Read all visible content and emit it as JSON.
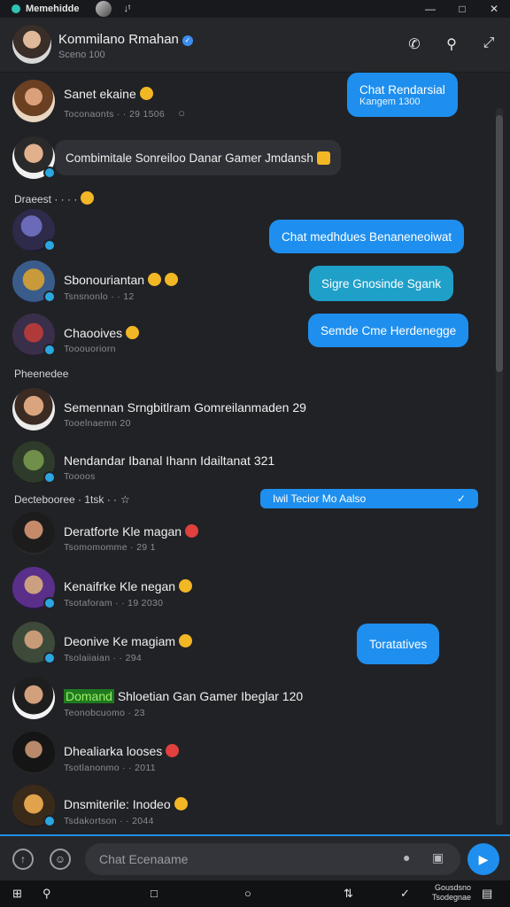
{
  "titlebar": {
    "app_name": "Memehidde",
    "tab_label": "↓ᵗ",
    "minimize": "—",
    "maximize": "□",
    "close": "✕"
  },
  "header": {
    "name": "Kommilano Rmahan",
    "status": "Sceno 100",
    "verified": "✓"
  },
  "rows": [
    {
      "name": "Sanet ekaine",
      "meta": "Toconaonts · · 29 1506"
    },
    {
      "gray_bubble": "Combimitale Sonreiloo Danar Gamer Jmdansh"
    },
    {
      "section": "Draeest · · · ·"
    },
    {
      "name": "",
      "meta": ""
    },
    {
      "name": "Sbonouriantan",
      "meta": "Tsnsnonlo · · 12"
    },
    {
      "name": "Chaooives",
      "meta": "Tooouoriorn"
    },
    {
      "section": "Pheenedee"
    },
    {
      "name": "Semennan Srngbitlram Gomreilanmaden 29",
      "meta": "Tooelnaemn 20"
    },
    {
      "name": "Nendandar Ibanal Ihann Idailtanat 321",
      "meta": "Toooos"
    },
    {
      "section": "Dectebooree · 1tsk · ·"
    },
    {
      "name": "Deratforte Kle magan",
      "meta": "Tsomomomme · 29 1"
    },
    {
      "name": "Kenaifrke Kle negan",
      "meta": "Tsotaforam · · 19 2030"
    },
    {
      "name": "Deonive Ke magiam",
      "meta": "Tsolaiiaian · · 294"
    },
    {
      "name_prefix": "Domand",
      "name": "Shloetian Gan Gamer Ibeglar 120",
      "meta": "Teonobcuomo · 23"
    },
    {
      "name": "Dhealiarka looses",
      "meta": "Tsotlanonmo · · 2011"
    },
    {
      "name": "Dnsmiterile: Inodeo",
      "meta": "Tsdakortson · · 2044"
    }
  ],
  "bubbles": [
    {
      "text": "Chat Rendarsial",
      "sub": "Kangem 1300",
      "style": "blue"
    },
    {
      "text": "Chat medhdues Benaneneoiwat",
      "style": "blue"
    },
    {
      "text": "Sigre Gnosinde Sgank",
      "style": "teal"
    },
    {
      "text": "Semde Cme Herdenegge",
      "style": "blue"
    },
    {
      "text": "Iwil Tecior Mo Aalso",
      "style": "blue"
    },
    {
      "text": "Toratatives",
      "style": "blue"
    }
  ],
  "composer": {
    "placeholder": "Chat Ecenaame"
  },
  "taskbar": {
    "clock_line1": "Gousdsno",
    "clock_line2": "Tsodegnae"
  },
  "colors": {
    "accent": "#1e8fee",
    "background": "#212226",
    "teal": "#1fa0c9"
  }
}
